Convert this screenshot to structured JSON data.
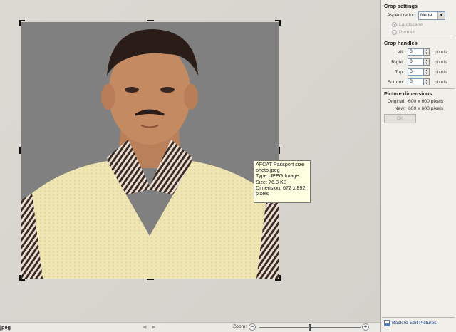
{
  "tooltip": {
    "lines": [
      "AFCAT Passport size",
      "photo.jpeg",
      "Type: JPEG Image",
      "Size: 76.3 KB",
      "Dimension: 672 x 892",
      "pixels"
    ]
  },
  "crop_settings": {
    "title": "Crop settings",
    "aspect_ratio_label": "Aspect ratio:",
    "aspect_ratio_value": "None",
    "landscape_label": "Landscape",
    "portrait_label": "Portrait"
  },
  "crop_handles": {
    "title": "Crop handles",
    "left_label": "Left:",
    "left_value": "0",
    "right_label": "Right:",
    "right_value": "0",
    "top_label": "Top:",
    "top_value": "0",
    "bottom_label": "Bottom:",
    "bottom_value": "0",
    "unit": "pixels"
  },
  "picture_dimensions": {
    "title": "Picture dimensions",
    "original_label": "Original:",
    "original_value": "600 x 600 pixels",
    "new_label": "New:",
    "new_value": "600 x 600 pixels",
    "ok_label": "OK"
  },
  "back_link_label": "Back to Edit Pictures",
  "status_bar": {
    "file_name": "jpeg",
    "zoom_label": "Zoom:",
    "zoom_level": 0.5
  },
  "colors": {
    "photo_background": "#808080",
    "sweater": "#f0e6b4",
    "tooltip_background": "#ffffe1",
    "link": "#0b3a8f"
  },
  "icons": [
    "crop-handle",
    "dropdown-arrow-icon",
    "spin-up-icon",
    "spin-down-icon",
    "prev-arrow-icon",
    "next-arrow-icon",
    "zoom-out-icon",
    "zoom-in-icon",
    "document-icon"
  ]
}
